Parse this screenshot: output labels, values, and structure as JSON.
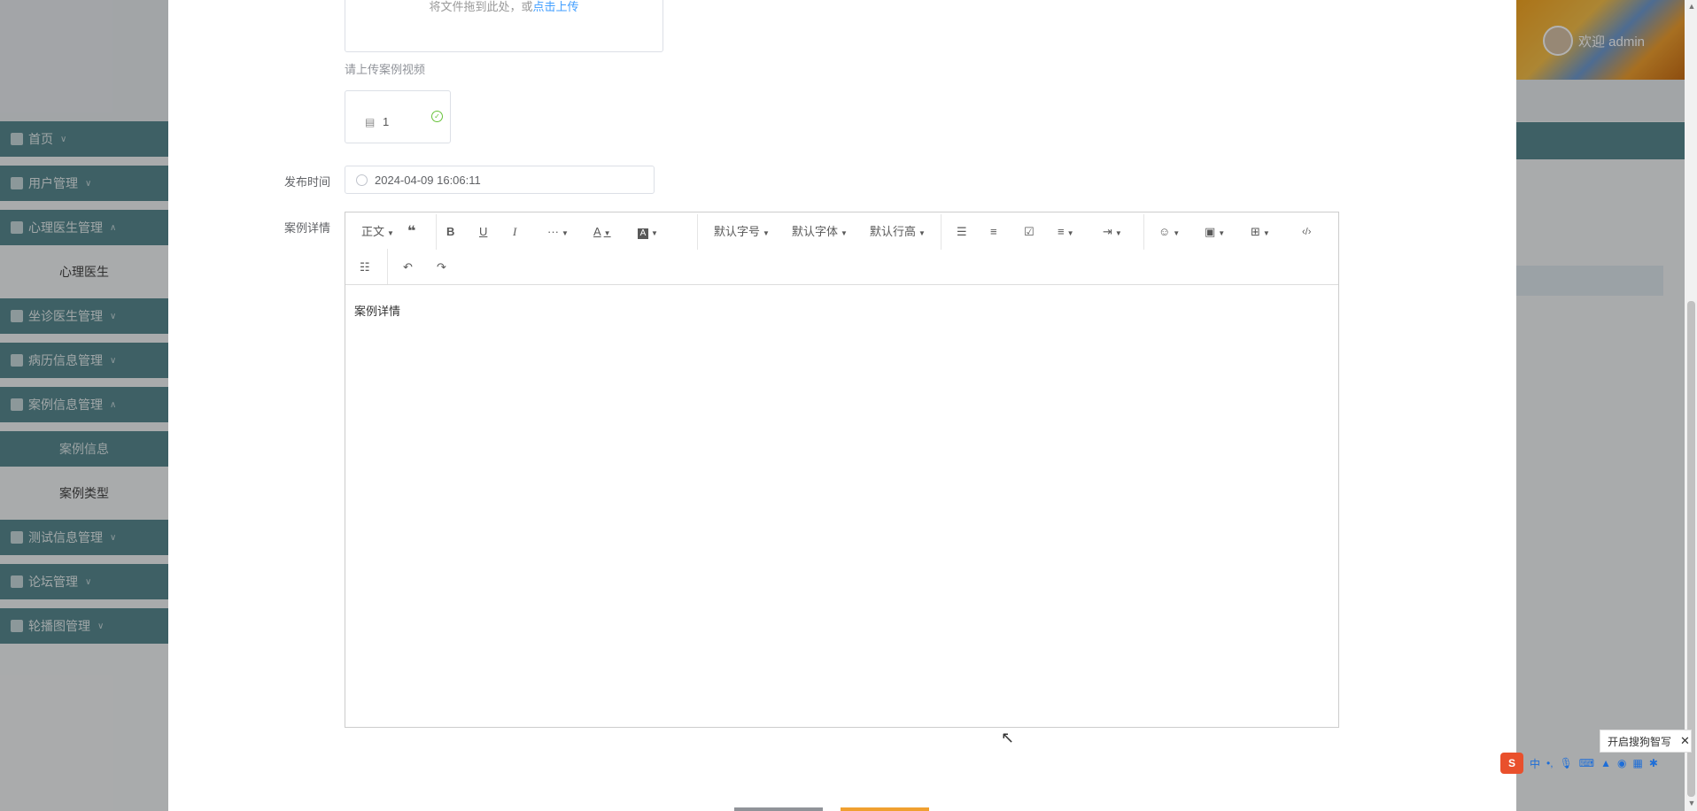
{
  "header": {
    "welcome": "欢迎 admin"
  },
  "sidebar": {
    "items": [
      {
        "label": "首页"
      },
      {
        "label": "用户管理"
      },
      {
        "label": "心理医生管理"
      },
      {
        "label": "坐诊医生管理"
      },
      {
        "label": "病历信息管理"
      },
      {
        "label": "案例信息管理"
      },
      {
        "label": "测试信息管理"
      },
      {
        "label": "论坛管理"
      },
      {
        "label": "轮播图管理"
      }
    ],
    "sub": {
      "doctor": "心理医生",
      "case_info": "案例信息",
      "case_type": "案例类型"
    }
  },
  "form": {
    "upload_text": "将文件拖到此处，或",
    "upload_link": "点击上传",
    "video_hint": "请上传案例视频",
    "file_name": "1",
    "publish_label": "发布时间",
    "publish_value": "2024-04-09 16:06:11",
    "detail_label": "案例详情"
  },
  "editor": {
    "toolbar": {
      "paragraph": "正文",
      "more": "···",
      "font_size": "默认字号",
      "font_family": "默认字体",
      "line_height": "默认行高",
      "code": "‹/›"
    },
    "content": "案例详情"
  },
  "ime": {
    "tip": "开启搜狗智写",
    "zh": "中"
  }
}
